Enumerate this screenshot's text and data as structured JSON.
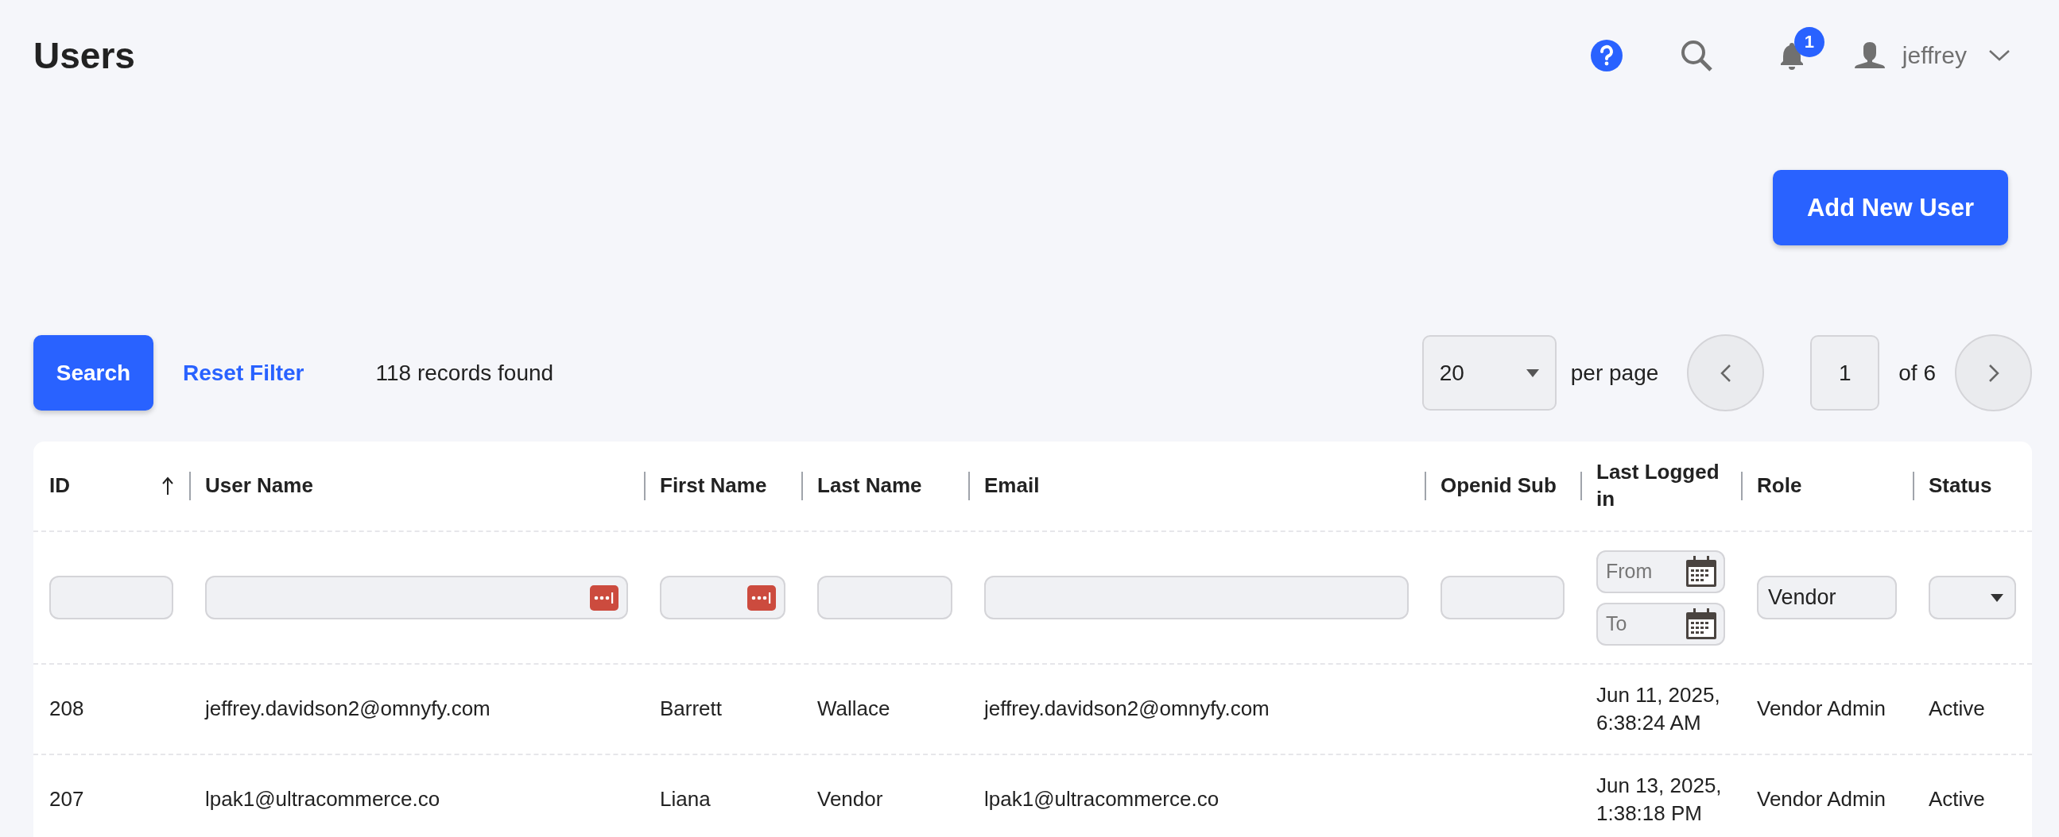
{
  "page": {
    "title": "Users"
  },
  "header": {
    "notification_count": "1",
    "user_name": "jeffrey"
  },
  "actions": {
    "add_button": "Add New User"
  },
  "toolbar": {
    "search_button": "Search",
    "reset_link": "Reset Filter",
    "records": "118 records found",
    "per_page_value": "20",
    "per_page_label": "per page",
    "page_value": "1",
    "page_total": "of 6"
  },
  "table": {
    "columns": [
      {
        "label": "ID",
        "sorted": true
      },
      {
        "label": "User Name",
        "sorted": false
      },
      {
        "label": "First Name",
        "sorted": false
      },
      {
        "label": "Last Name",
        "sorted": false
      },
      {
        "label": "Email",
        "sorted": false
      },
      {
        "label": "Openid Sub",
        "sorted": false
      },
      {
        "label": "Last Logged in",
        "sorted": false
      },
      {
        "label": "Role",
        "sorted": false
      },
      {
        "label": "Status",
        "sorted": false
      }
    ],
    "filters": [
      {
        "kind": "text",
        "password_icon": false
      },
      {
        "kind": "text",
        "password_icon": true
      },
      {
        "kind": "text",
        "password_icon": true
      },
      {
        "kind": "text",
        "password_icon": false
      },
      {
        "kind": "text",
        "password_icon": false
      },
      {
        "kind": "text",
        "password_icon": false
      },
      {
        "kind": "date-range",
        "from_placeholder": "From",
        "to_placeholder": "To"
      },
      {
        "kind": "text",
        "password_icon": false,
        "value": "Vendor"
      },
      {
        "kind": "select"
      }
    ],
    "rows": [
      {
        "cells": [
          "208",
          "jeffrey.davidson2@omnyfy.com",
          "Barrett",
          "Wallace",
          "jeffrey.davidson2@omnyfy.com",
          "",
          "Jun 11, 2025, 6:38:24 AM",
          "Vendor Admin",
          "Active"
        ]
      },
      {
        "cells": [
          "207",
          "lpak1@ultracommerce.co",
          "Liana",
          "Vendor",
          "lpak1@ultracommerce.co",
          "",
          "Jun 13, 2025, 1:38:18 PM",
          "Vendor Admin",
          "Active"
        ]
      }
    ]
  }
}
